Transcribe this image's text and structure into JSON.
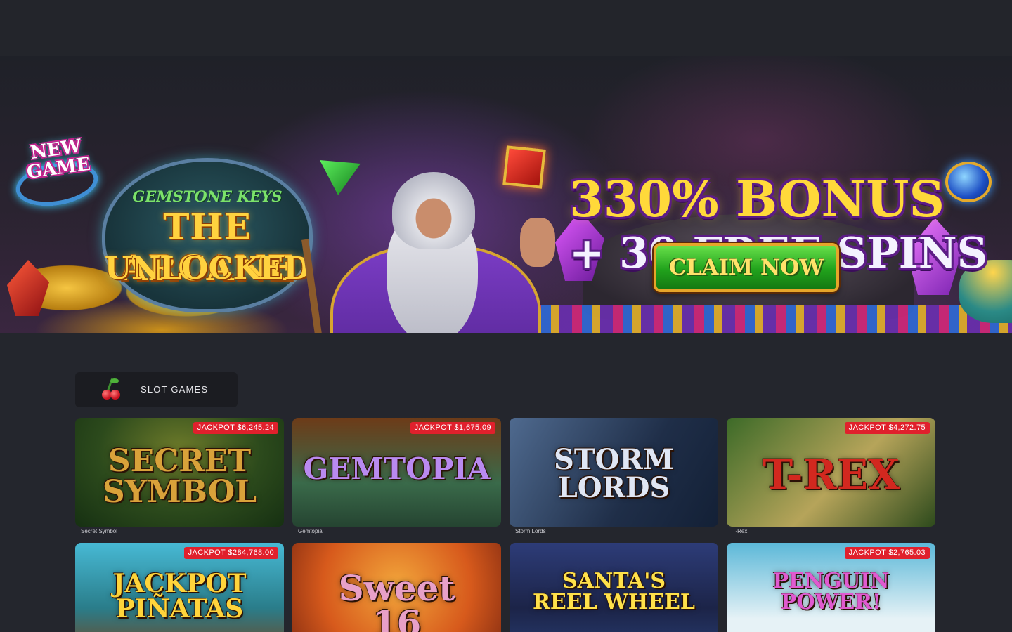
{
  "hero": {
    "badge": "NEW\nGAME",
    "logo_sub": "GEMSTONE KEYS",
    "logo_line1": "THE ARCANE",
    "logo_line2": "UNLOCKED",
    "promo_line1": "330% BONUS",
    "promo_line2": "+ 30 FREE SPINS",
    "cta_label": "CLAIM NOW"
  },
  "section": {
    "tab_label": "SLOT GAMES",
    "tab_icon": "cherry-icon"
  },
  "games": [
    {
      "title": "Secret Symbol",
      "art": "SECRET\nSYMBOL",
      "jackpot": "JACKPOT $6,245.24",
      "art_color": "#d9a23a"
    },
    {
      "title": "Gemtopia",
      "art": "GEMTOPIA",
      "jackpot": "JACKPOT $1,675.09",
      "art_color": "#b98af0"
    },
    {
      "title": "Storm Lords",
      "art": "STORM\nLORDS",
      "jackpot": "",
      "art_color": "#dfe6f4"
    },
    {
      "title": "T-Rex",
      "art": "T-REX",
      "jackpot": "JACKPOT $4,272.75",
      "art_color": "#d2281f"
    },
    {
      "title": "",
      "art": "JACKPOT\nPIÑATAS",
      "jackpot": "JACKPOT $284,768.00",
      "art_color": "#ffd43b"
    },
    {
      "title": "",
      "art": "Sweet\n16",
      "jackpot": "",
      "art_color": "#e8a0c8"
    },
    {
      "title": "",
      "art": "SANTA'S\nREEL WHEEL",
      "jackpot": "",
      "art_color": "#ffe14a"
    },
    {
      "title": "",
      "art": "PENGUIN\nPOWER!",
      "jackpot": "JACKPOT $2,765.03",
      "art_color": "#e05ad0"
    }
  ]
}
